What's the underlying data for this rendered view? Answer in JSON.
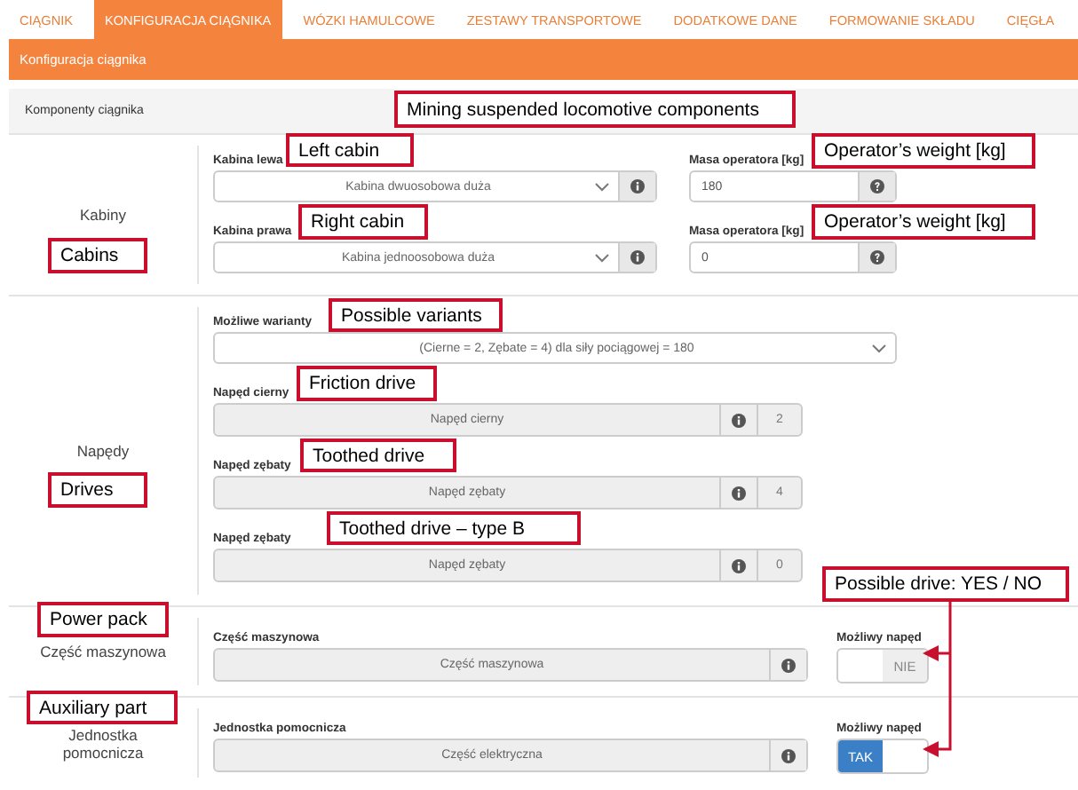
{
  "tabs": [
    {
      "label": "CIĄGNIK",
      "selected": false
    },
    {
      "label": "KONFIGURACJA CIĄGNIKA",
      "selected": true
    },
    {
      "label": "WÓZKI HAMULCOWE",
      "selected": false
    },
    {
      "label": "ZESTAWY TRANSPORTOWE",
      "selected": false
    },
    {
      "label": "DODATKOWE DANE",
      "selected": false
    },
    {
      "label": "FORMOWANIE SKŁADU",
      "selected": false
    },
    {
      "label": "CIĘGŁA",
      "selected": false
    }
  ],
  "panel_title": "Konfiguracja ciągnika",
  "section_heading": "Komponenty ciągnika",
  "sections": [
    {
      "label": "Kabiny",
      "items": [
        {
          "kind": "cabin",
          "label": "Kabina lewa",
          "value": "Kabina dwuosobowa duża",
          "weight_label": "Masa operatora [kg]",
          "weight": "180"
        },
        {
          "kind": "cabin",
          "label": "Kabina prawa",
          "value": "Kabina jednoosobowa duża",
          "weight_label": "Masa operatora [kg]",
          "weight": "0"
        }
      ]
    },
    {
      "label": "Napędy",
      "items": [
        {
          "kind": "variants",
          "label": "Możliwe warianty",
          "value": "(Cierne = 2, Zębate = 4) dla siły pociągowej = 180"
        },
        {
          "kind": "drive",
          "label": "Napęd cierny",
          "value": "Napęd cierny",
          "count": "2"
        },
        {
          "kind": "drive",
          "label": "Napęd zębaty",
          "value": "Napęd zębaty",
          "count": "4"
        },
        {
          "kind": "drive",
          "label": "Napęd zębaty",
          "value": "Napęd zębaty",
          "count": "0"
        }
      ]
    },
    {
      "label": "Część maszynowa",
      "items": [
        {
          "kind": "part",
          "label": "Część maszynowa",
          "value": "Część maszynowa",
          "toggle_label": "Możliwy napęd",
          "toggle_text": "NIE",
          "on": false
        }
      ]
    },
    {
      "label": "Jednostka pomocnicza",
      "items": [
        {
          "kind": "part",
          "label": "Jednostka pomocnicza",
          "value": "Część elektryczna",
          "toggle_label": "Możliwy napęd",
          "toggle_text": "TAK",
          "on": true
        }
      ]
    }
  ],
  "annotations": [
    {
      "text": "Mining suspended locomotive components"
    },
    {
      "text": "Left cabin"
    },
    {
      "text": "Operator’s weight [kg]"
    },
    {
      "text": "Right cabin"
    },
    {
      "text": "Operator’s weight [kg]"
    },
    {
      "text": "Cabins"
    },
    {
      "text": "Possible variants"
    },
    {
      "text": "Friction drive"
    },
    {
      "text": "Toothed drive"
    },
    {
      "text": "Drives"
    },
    {
      "text": "Toothed drive – type B"
    },
    {
      "text": "Possible drive: YES / NO"
    },
    {
      "text": "Power pack"
    },
    {
      "text": "Auxiliary part"
    }
  ]
}
